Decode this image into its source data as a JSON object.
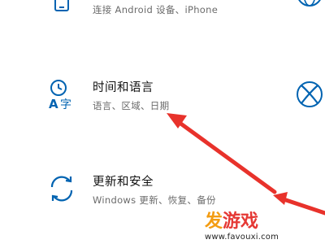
{
  "tiles": [
    {
      "id": "phone",
      "title": "",
      "subtitle": "连接 Android 设备、iPhone"
    },
    {
      "id": "time_language",
      "title": "时间和语言",
      "subtitle": "语言、区域、日期"
    },
    {
      "id": "update_security",
      "title": "更新和安全",
      "subtitle": "Windows 更新、恢复、备份"
    }
  ],
  "icons": {
    "phone": "phone-icon",
    "time_language": "time-language-icon",
    "update_security": "update-sync-icon",
    "right_top": "globe-icon",
    "right_mid": "xbox-icon"
  },
  "watermark": {
    "logo": "发游戏",
    "url": "www.favouxi.com"
  },
  "colors": {
    "accent": "#0063b1",
    "arrow": "#e8322b",
    "watermark_orange": "#f39c12",
    "watermark_red": "#e53935"
  }
}
